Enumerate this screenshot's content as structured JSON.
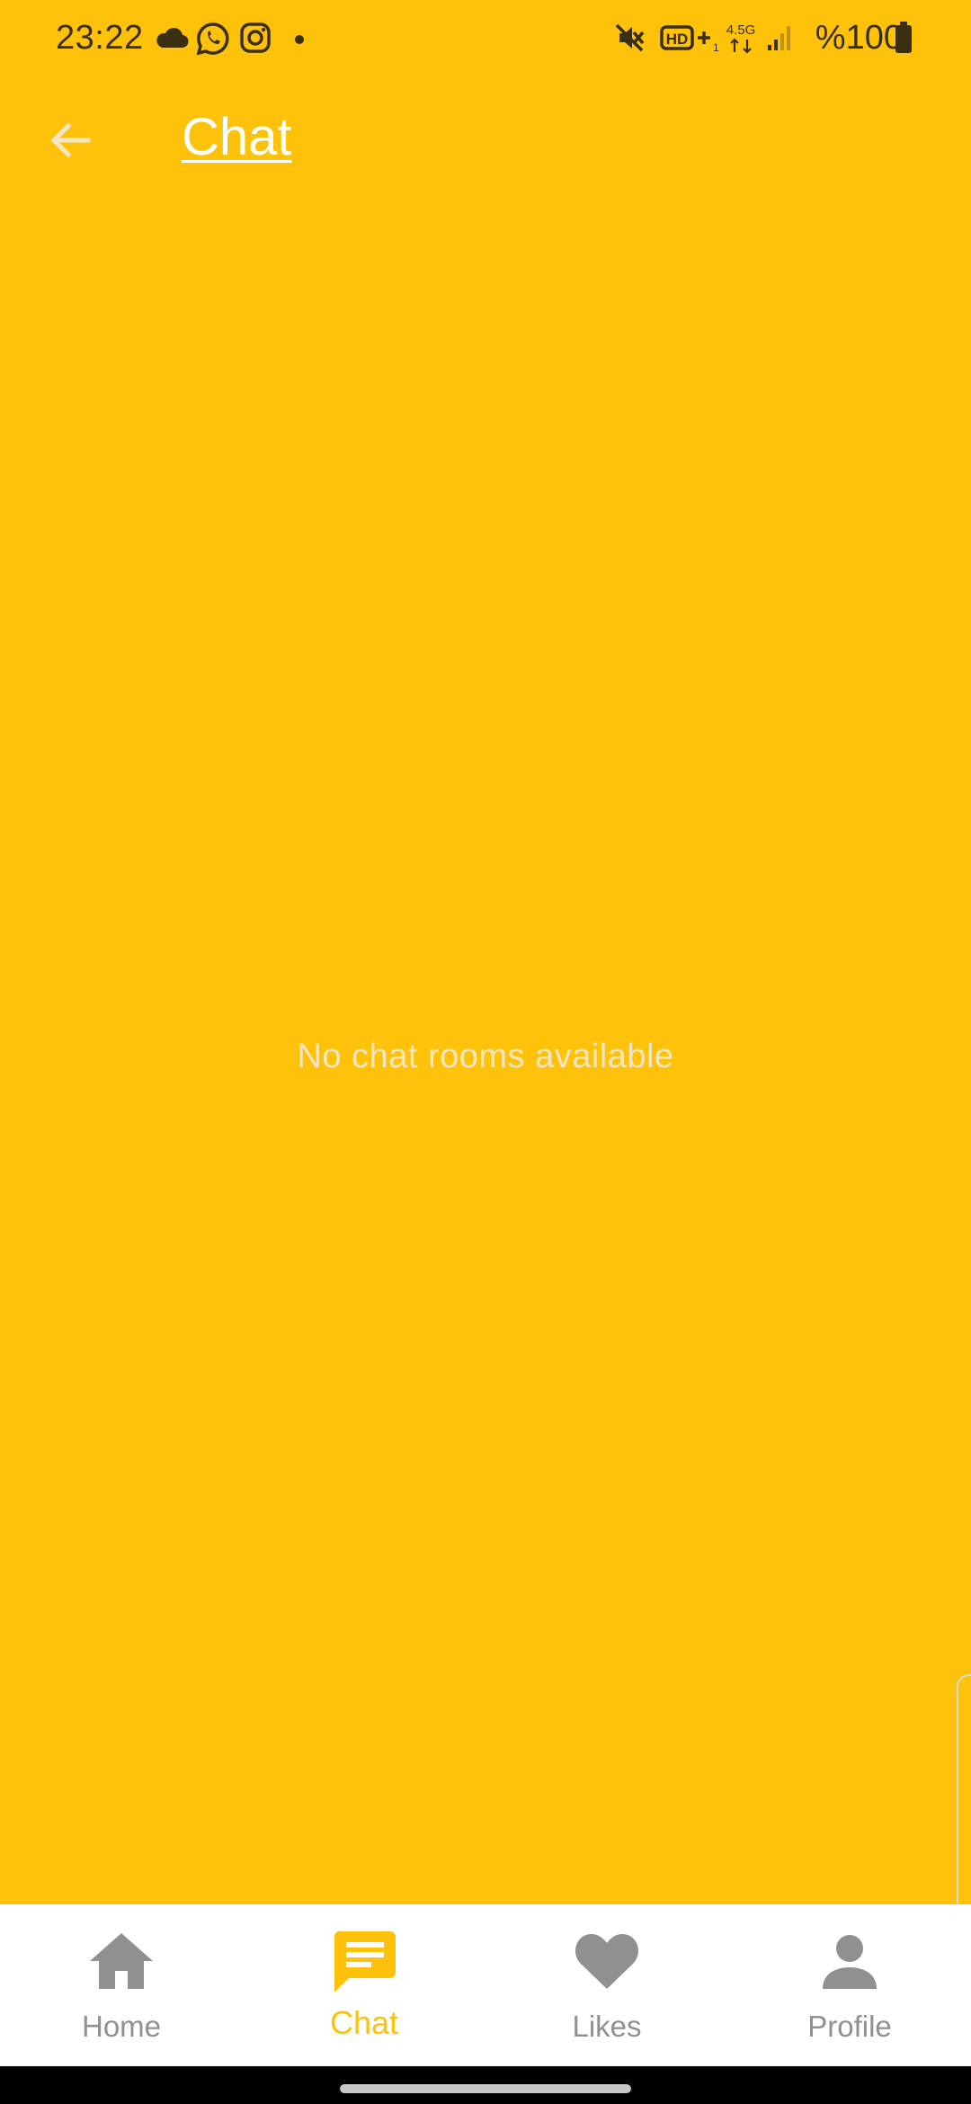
{
  "status_bar": {
    "time": "23:22",
    "battery": "%100",
    "left_icons": [
      "cloud-icon",
      "whatsapp-icon",
      "instagram-icon",
      "notification-dot-icon"
    ],
    "right_icons": [
      "mute-icon",
      "hd-plus-icon",
      "network-4-5g-icon",
      "signal-icon",
      "battery-icon"
    ],
    "network_label": "4.5G"
  },
  "app_bar": {
    "back_icon": "arrow-left-icon",
    "title": "Chat"
  },
  "main": {
    "empty_message": "No chat rooms available"
  },
  "bottom_nav": {
    "items": [
      {
        "label": "Home",
        "icon": "home-icon",
        "active": false
      },
      {
        "label": "Chat",
        "icon": "chat-icon",
        "active": true
      },
      {
        "label": "Likes",
        "icon": "heart-icon",
        "active": false
      },
      {
        "label": "Profile",
        "icon": "person-icon",
        "active": false
      }
    ]
  },
  "colors": {
    "background": "#FEC20A",
    "title": "#FFFFFF",
    "empty_message": "#F3E6C6",
    "nav_background": "#FFFFFF",
    "nav_inactive": "#909090",
    "nav_active": "#FEC20A"
  }
}
